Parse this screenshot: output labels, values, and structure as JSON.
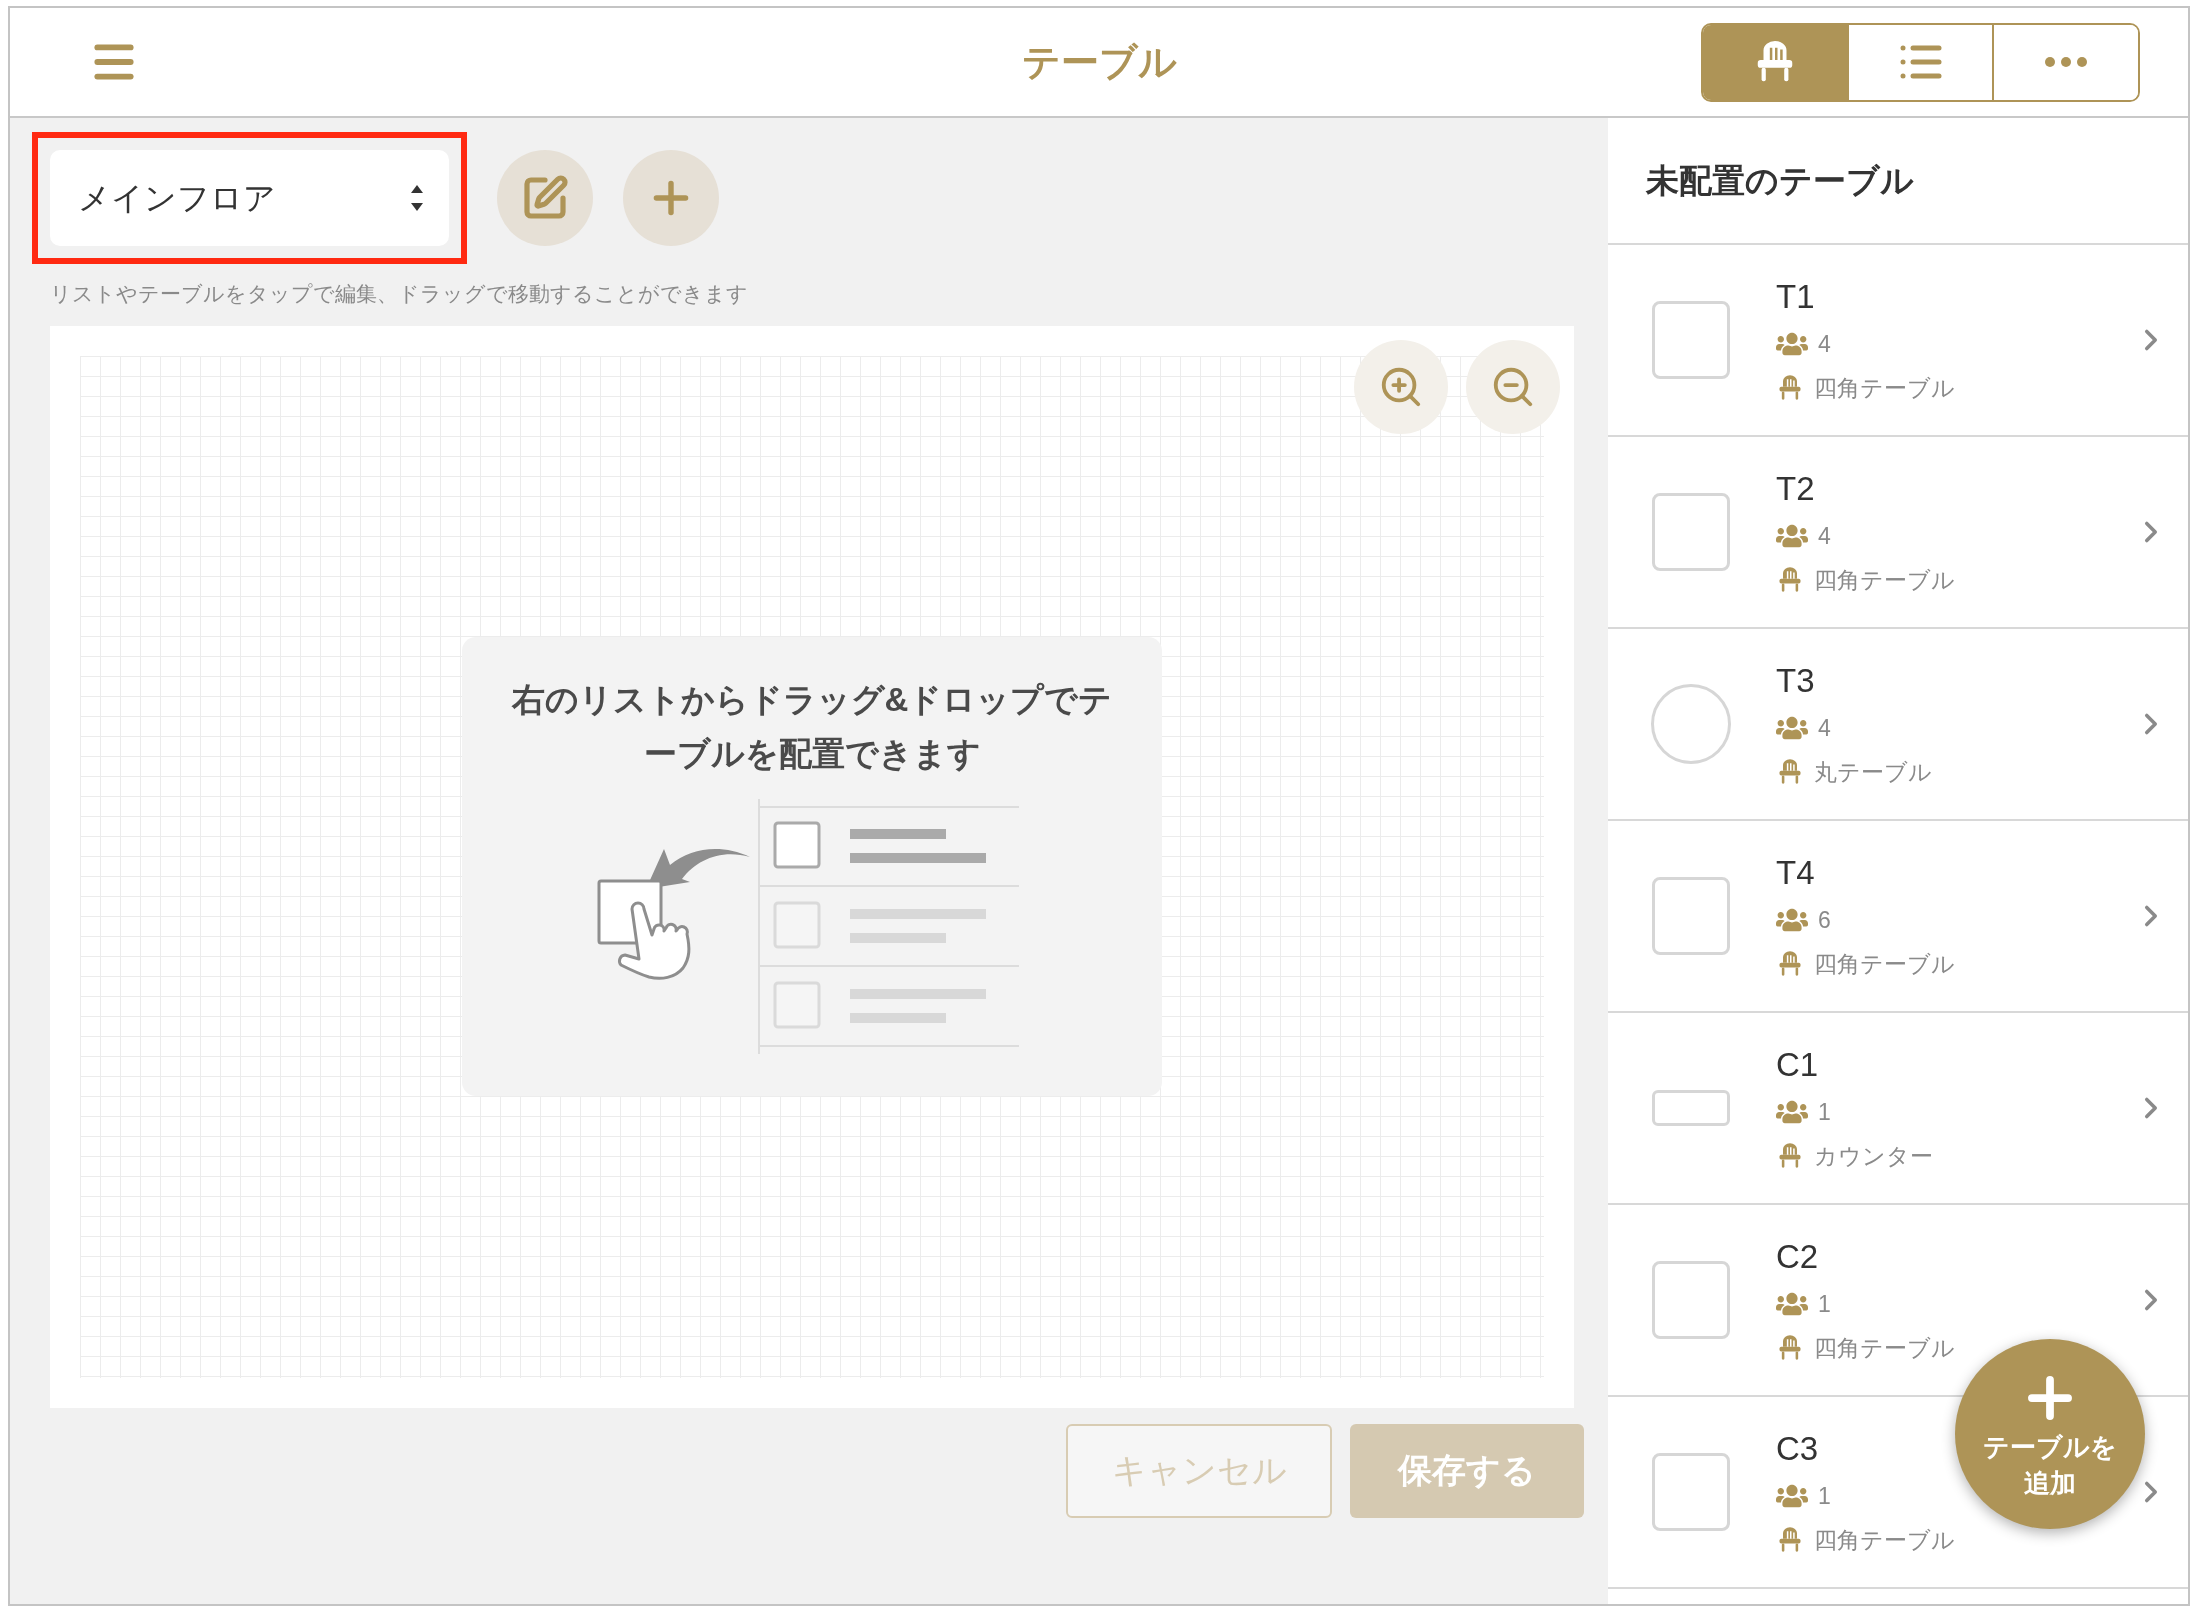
{
  "header": {
    "title": "テーブル"
  },
  "view_tabs": [
    {
      "kind": "floor",
      "selected": true
    },
    {
      "kind": "list",
      "selected": false
    },
    {
      "kind": "more",
      "selected": false
    }
  ],
  "floor_selector": {
    "value": "メインフロア",
    "highlighted": true
  },
  "hint": "リストやテーブルをタップで編集、ドラッグで移動することができます",
  "canvas": {
    "message": "右のリストからドラッグ&ドロップでテーブルを配置できます"
  },
  "actions": [
    {
      "kind": "cancel",
      "label": "キャンセル",
      "disabled": true
    },
    {
      "kind": "save",
      "label": "保存する",
      "disabled": true
    }
  ],
  "unplaced": {
    "title": "未配置のテーブル",
    "tables": [
      {
        "name": "T1",
        "seats": "4",
        "type": "四角テーブル",
        "kind": "square"
      },
      {
        "name": "T2",
        "seats": "4",
        "type": "四角テーブル",
        "kind": "square"
      },
      {
        "name": "T3",
        "seats": "4",
        "type": "丸テーブル",
        "kind": "circle"
      },
      {
        "name": "T4",
        "seats": "6",
        "type": "四角テーブル",
        "kind": "square"
      },
      {
        "name": "C1",
        "seats": "1",
        "type": "カウンター",
        "kind": "counter"
      },
      {
        "name": "C2",
        "seats": "1",
        "type": "四角テーブル",
        "kind": "square"
      },
      {
        "name": "C3",
        "seats": "1",
        "type": "四角テーブル",
        "kind": "square"
      }
    ]
  },
  "fab": {
    "lines": [
      "テーブルを",
      "追加"
    ]
  }
}
